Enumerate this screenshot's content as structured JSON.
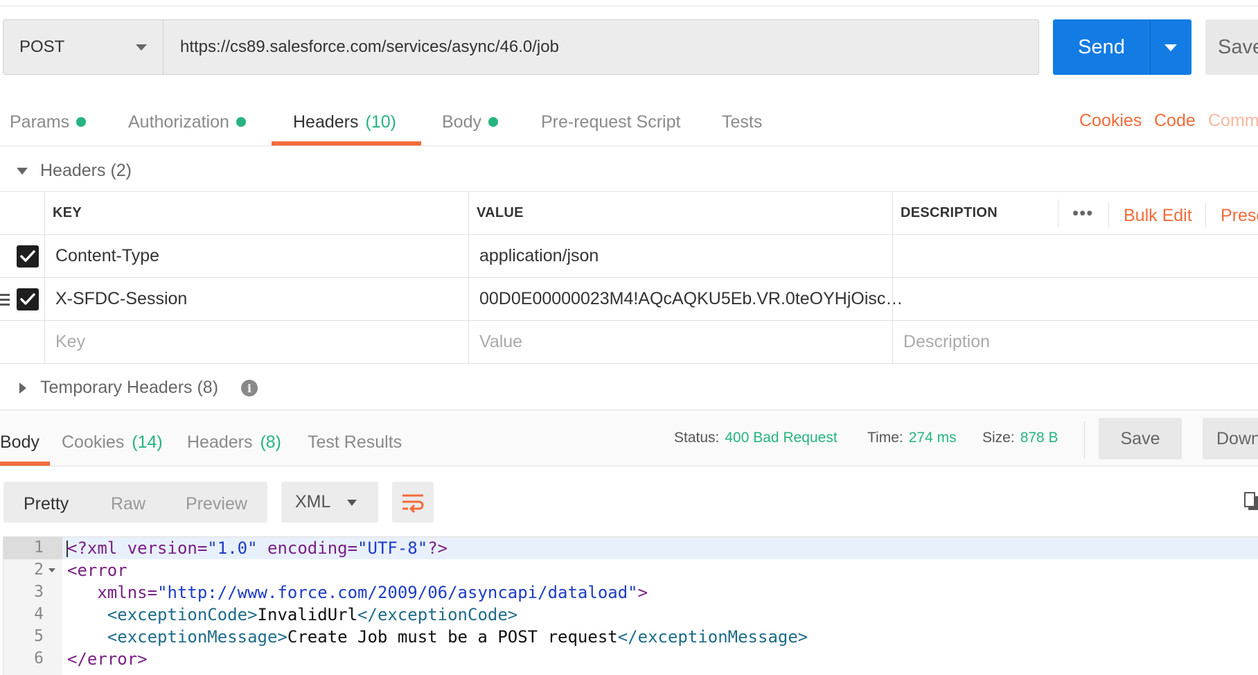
{
  "request": {
    "method": "POST",
    "url": "https://cs89.salesforce.com/services/async/46.0/job",
    "send_label": "Send",
    "save_label": "Save"
  },
  "request_tabs": [
    {
      "label": "Params",
      "dot": true
    },
    {
      "label": "Authorization",
      "dot": true
    },
    {
      "label": "Headers",
      "count": "(10)",
      "active": true
    },
    {
      "label": "Body",
      "dot": true
    },
    {
      "label": "Pre-request Script"
    },
    {
      "label": "Tests"
    }
  ],
  "right_links": {
    "cookies": "Cookies",
    "code": "Code",
    "comments": "Comm"
  },
  "headers_section": {
    "title": "Headers",
    "count": "(2)",
    "columns": {
      "key": "KEY",
      "value": "VALUE",
      "description": "DESCRIPTION"
    },
    "more": "•••",
    "bulk_edit": "Bulk Edit",
    "presets": "Prese",
    "rows": [
      {
        "key": "Content-Type",
        "value": "application/json",
        "checked": true
      },
      {
        "key": "X-SFDC-Session",
        "value": "00D0E00000023M4!AQcAQKU5Eb.VR.0teOYHjOisc…",
        "checked": true
      }
    ],
    "placeholders": {
      "key": "Key",
      "value": "Value",
      "description": "Description"
    }
  },
  "temporary_headers": {
    "title": "Temporary Headers",
    "count": "(8)",
    "info": "i"
  },
  "response": {
    "tabs": [
      {
        "label": "Body",
        "active": true
      },
      {
        "label": "Cookies",
        "count": "(14)"
      },
      {
        "label": "Headers",
        "count": "(8)"
      },
      {
        "label": "Test Results"
      }
    ],
    "status_label": "Status:",
    "status_value": "400 Bad Request",
    "time_label": "Time:",
    "time_value": "274 ms",
    "size_label": "Size:",
    "size_value": "878 B",
    "save_label": "Save",
    "download_label": "Down"
  },
  "viewer": {
    "modes": [
      "Pretty",
      "Raw",
      "Preview"
    ],
    "active_mode": "Pretty",
    "format": "XML"
  },
  "code_lines": [
    {
      "n": "1",
      "html": [
        [
          "t-tag",
          "<?xml"
        ],
        [
          "t-text",
          " "
        ],
        [
          "t-attr",
          "version="
        ],
        [
          "t-str",
          "\"1.0\""
        ],
        [
          "t-text",
          " "
        ],
        [
          "t-attr",
          "encoding="
        ],
        [
          "t-str",
          "\"UTF-8\""
        ],
        [
          "t-tag",
          "?>"
        ]
      ]
    },
    {
      "n": "2",
      "html": [
        [
          "t-tag",
          "<error"
        ]
      ]
    },
    {
      "n": "3",
      "html": [
        [
          "t-text",
          "   "
        ],
        [
          "t-attr",
          "xmlns="
        ],
        [
          "t-str",
          "\"http://www.force.com/2009/06/asyncapi/dataload\""
        ],
        [
          "t-tag",
          ">"
        ]
      ]
    },
    {
      "n": "4",
      "html": [
        [
          "t-text",
          "    "
        ],
        [
          "t-ctag",
          "<exceptionCode>"
        ],
        [
          "t-text",
          "InvalidUrl"
        ],
        [
          "t-ctag",
          "</exceptionCode>"
        ]
      ]
    },
    {
      "n": "5",
      "html": [
        [
          "t-text",
          "    "
        ],
        [
          "t-ctag",
          "<exceptionMessage>"
        ],
        [
          "t-text",
          "Create Job must be a POST request"
        ],
        [
          "t-ctag",
          "</exceptionMessage>"
        ]
      ]
    },
    {
      "n": "6",
      "html": [
        [
          "t-tag",
          "</error>"
        ]
      ]
    }
  ],
  "colors": {
    "accent": "#f26b3a",
    "send": "#127ce4",
    "success": "#26b47f"
  }
}
